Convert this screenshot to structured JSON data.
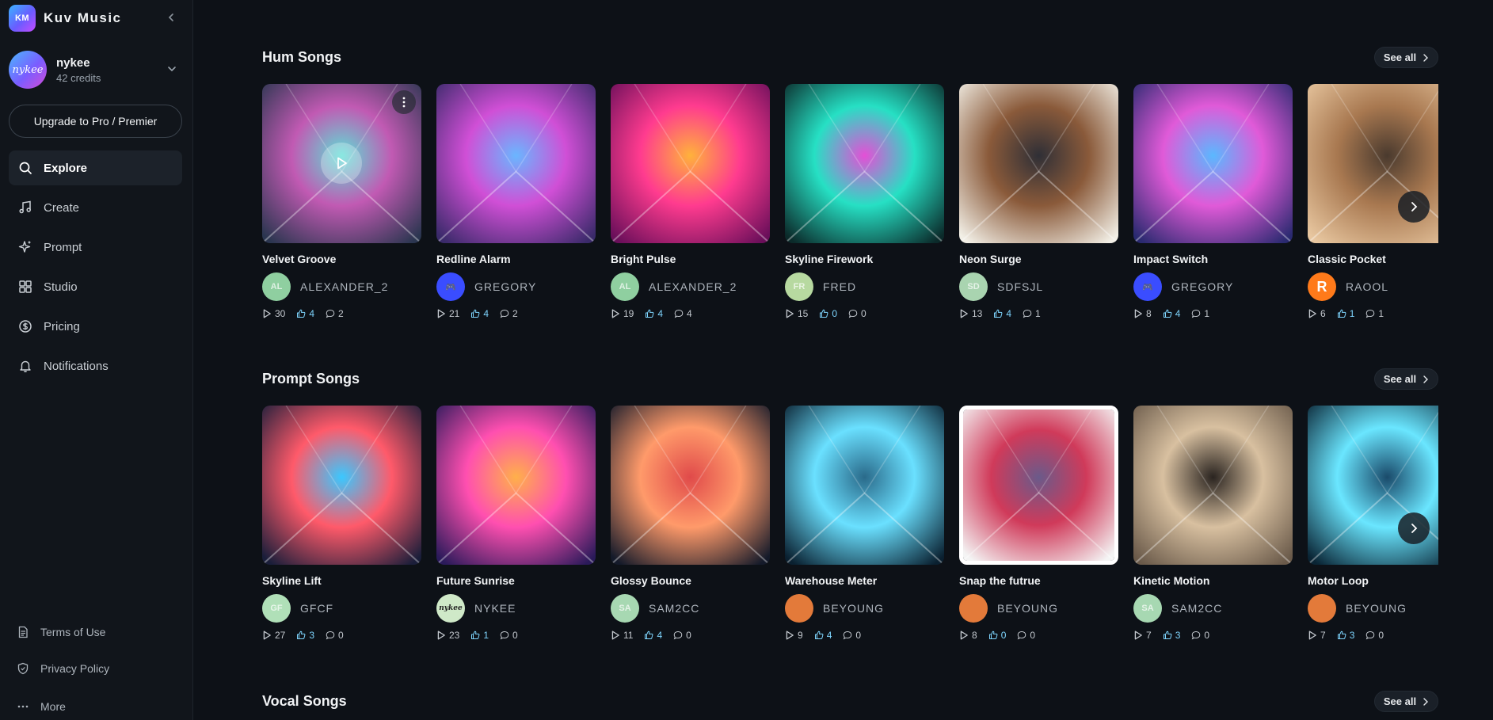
{
  "brand": {
    "logo_text": "KM",
    "name": "Kuv Music"
  },
  "user": {
    "avatar_text": "nykee",
    "name": "nykee",
    "credits": "42 credits"
  },
  "upgrade_label": "Upgrade to Pro / Premier",
  "nav": [
    {
      "label": "Explore",
      "icon": "search-icon",
      "active": true
    },
    {
      "label": "Create",
      "icon": "music-note-icon"
    },
    {
      "label": "Prompt",
      "icon": "sparkle-icon"
    },
    {
      "label": "Studio",
      "icon": "grid-icon"
    },
    {
      "label": "Pricing",
      "icon": "coin-icon"
    },
    {
      "label": "Notifications",
      "icon": "bell-icon"
    }
  ],
  "footer": {
    "terms": "Terms of Use",
    "privacy": "Privacy Policy",
    "more": "More"
  },
  "sections": [
    {
      "title": "Hum Songs",
      "see_all": "See all",
      "cards": [
        {
          "title": "Velvet Groove",
          "author": "ALEXANDER_2",
          "initials": "AL",
          "plays": "30",
          "likes": "4",
          "comments": "2"
        },
        {
          "title": "Redline Alarm",
          "author": "GREGORY",
          "initials": "🎮",
          "plays": "21",
          "likes": "4",
          "comments": "2"
        },
        {
          "title": "Bright Pulse",
          "author": "ALEXANDER_2",
          "initials": "AL",
          "plays": "19",
          "likes": "4",
          "comments": "4"
        },
        {
          "title": "Skyline Firework",
          "author": "FRED",
          "initials": "FR",
          "plays": "15",
          "likes": "0",
          "comments": "0"
        },
        {
          "title": "Neon Surge",
          "author": "SDFSJL",
          "initials": "SD",
          "plays": "13",
          "likes": "4",
          "comments": "1"
        },
        {
          "title": "Impact Switch",
          "author": "GREGORY",
          "initials": "🎮",
          "plays": "8",
          "likes": "4",
          "comments": "1"
        },
        {
          "title": "Classic Pocket",
          "author": "RAOOL",
          "initials": "R",
          "plays": "6",
          "likes": "1",
          "comments": "1"
        }
      ]
    },
    {
      "title": "Prompt Songs",
      "see_all": "See all",
      "cards": [
        {
          "title": "Skyline Lift",
          "author": "GFCF",
          "initials": "GF",
          "plays": "27",
          "likes": "3",
          "comments": "0"
        },
        {
          "title": "Future Sunrise",
          "author": "NYKEE",
          "initials": "nykee",
          "plays": "23",
          "likes": "1",
          "comments": "0"
        },
        {
          "title": "Glossy Bounce",
          "author": "SAM2CC",
          "initials": "SA",
          "plays": "11",
          "likes": "4",
          "comments": "0"
        },
        {
          "title": "Warehouse Meter",
          "author": "BEYOUNG",
          "initials": "",
          "plays": "9",
          "likes": "4",
          "comments": "0"
        },
        {
          "title": "Snap the futrue",
          "author": "BEYOUNG",
          "initials": "",
          "plays": "8",
          "likes": "0",
          "comments": "0"
        },
        {
          "title": "Kinetic Motion",
          "author": "SAM2CC",
          "initials": "SA",
          "plays": "7",
          "likes": "3",
          "comments": "0"
        },
        {
          "title": "Motor Loop",
          "author": "BEYOUNG",
          "initials": "",
          "plays": "7",
          "likes": "3",
          "comments": "0"
        }
      ]
    },
    {
      "title": "Vocal Songs",
      "see_all": "See all",
      "cards": []
    }
  ]
}
